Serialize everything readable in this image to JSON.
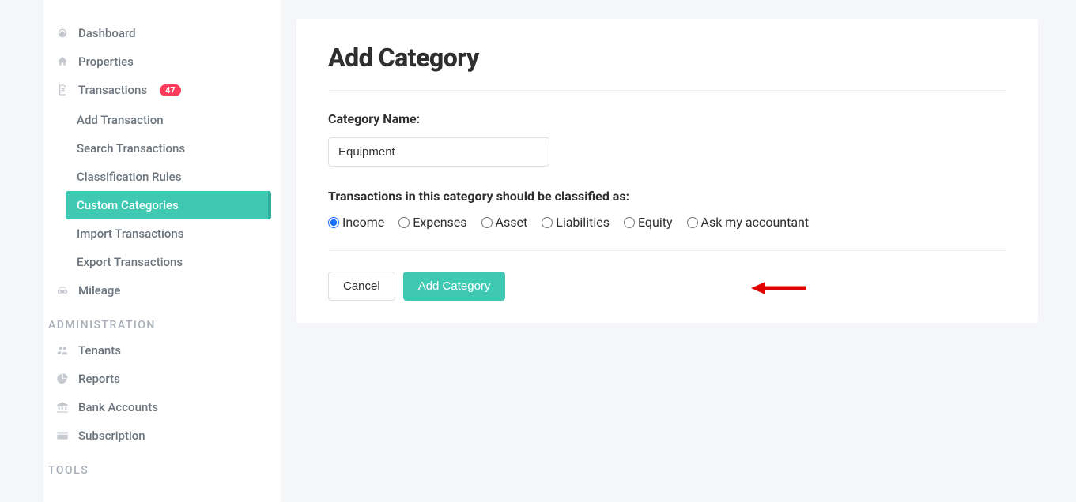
{
  "sidebar": {
    "items": {
      "dashboard": "Dashboard",
      "properties": "Properties",
      "transactions": {
        "label": "Transactions",
        "badge": "47"
      },
      "transactions_sub": {
        "add": "Add Transaction",
        "search": "Search Transactions",
        "rules": "Classification Rules",
        "custom": "Custom Categories",
        "import": "Import Transactions",
        "export": "Export Transactions"
      },
      "mileage": "Mileage"
    },
    "section_admin": "ADMINISTRATION",
    "admin": {
      "tenants": "Tenants",
      "reports": "Reports",
      "bank": "Bank Accounts",
      "subscription": "Subscription"
    },
    "section_tools": "TOOLS"
  },
  "main": {
    "title": "Add Category",
    "label_name": "Category Name:",
    "name_value": "Equipment",
    "label_classify": "Transactions in this category should be classified as:",
    "options": {
      "income": "Income",
      "expenses": "Expenses",
      "asset": "Asset",
      "liabilities": "Liabilities",
      "equity": "Equity",
      "ask": "Ask my accountant"
    },
    "cancel": "Cancel",
    "submit": "Add Category"
  }
}
